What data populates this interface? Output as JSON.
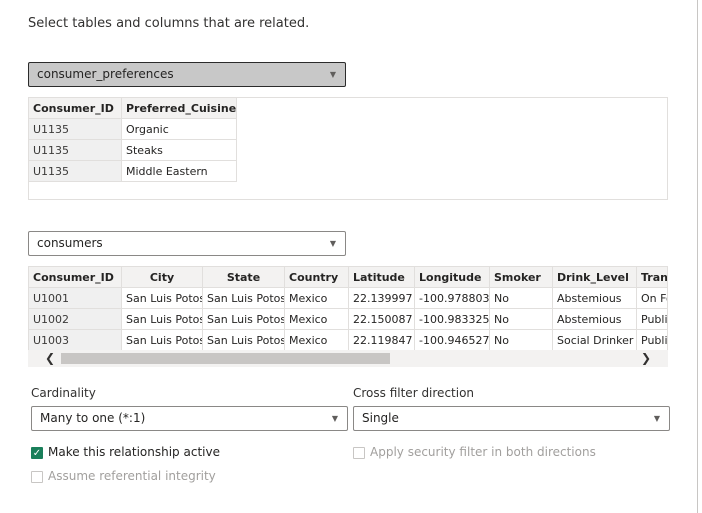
{
  "instruction": "Select tables and columns that are related.",
  "table1": {
    "selected": "consumer_preferences",
    "columns": [
      "Consumer_ID",
      "Preferred_Cuisine"
    ],
    "rows": [
      [
        "U1135",
        "Organic"
      ],
      [
        "U1135",
        "Steaks"
      ],
      [
        "U1135",
        "Middle Eastern"
      ]
    ]
  },
  "table2": {
    "selected": "consumers",
    "columns": [
      "Consumer_ID",
      "City",
      "State",
      "Country",
      "Latitude",
      "Longitude",
      "Smoker",
      "Drink_Level",
      "Trans"
    ],
    "rows": [
      [
        "U1001",
        "San Luis Potosi",
        "San Luis Potosi",
        "Mexico",
        "22.139997",
        "-100.978803",
        "No",
        "Abstemious",
        "On Fo"
      ],
      [
        "U1002",
        "San Luis Potosi",
        "San Luis Potosi",
        "Mexico",
        "22.150087",
        "-100.983325",
        "No",
        "Abstemious",
        "Public"
      ],
      [
        "U1003",
        "San Luis Potosi",
        "San Luis Potosi",
        "Mexico",
        "22.119847",
        "-100.946527",
        "No",
        "Social Drinker",
        "Public"
      ]
    ]
  },
  "cardinality": {
    "label": "Cardinality",
    "value": "Many to one (*:1)"
  },
  "cross_filter": {
    "label": "Cross filter direction",
    "value": "Single"
  },
  "checkboxes": {
    "active": {
      "label": "Make this relationship active",
      "checked": true
    },
    "security": {
      "label": "Apply security filter in both directions",
      "checked": false
    },
    "referential": {
      "label": "Assume referential integrity",
      "checked": false
    }
  },
  "icons": {
    "chevron": "chevron-down-icon",
    "scroll_left": "scroll-left-icon",
    "scroll_right": "scroll-right-icon",
    "check": "check-icon"
  },
  "colors": {
    "accent": "#1a7f5a",
    "selected_dropdown": "#c8c8c8"
  }
}
